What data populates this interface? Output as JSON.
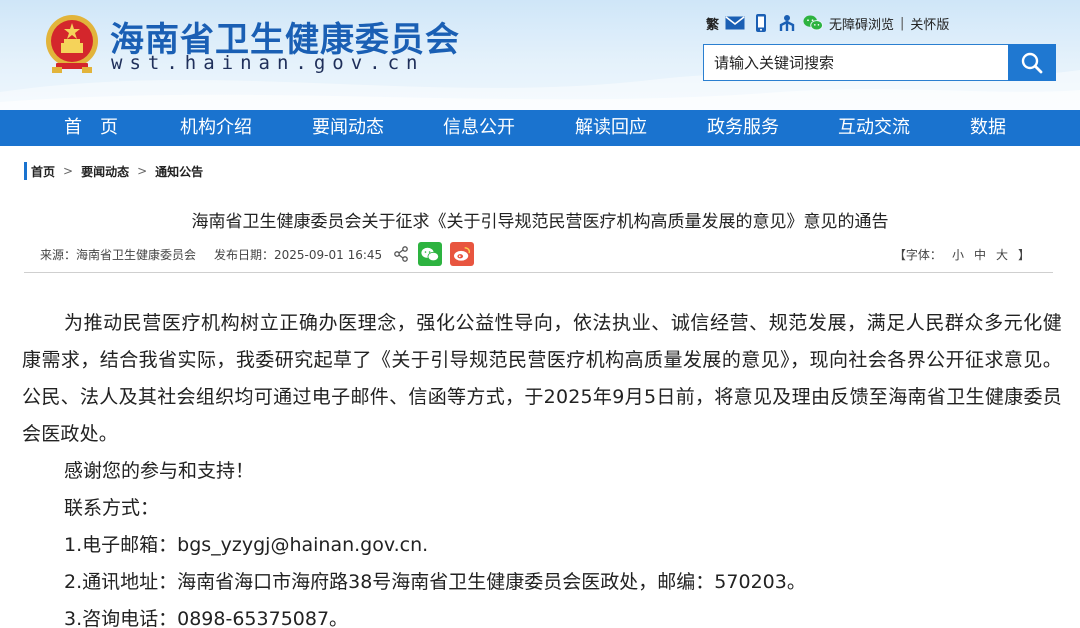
{
  "header": {
    "site_title": "海南省卫生健康委员会",
    "site_url": "wst.hainan.gov.cn",
    "tools": {
      "traditional": "繁",
      "accessibility": "无障碍浏览",
      "separator": "|",
      "care_mode": "关怀版"
    },
    "search": {
      "placeholder": "请输入关键词搜索"
    },
    "icons": [
      "mail-icon",
      "mobile-icon",
      "org-icon",
      "wechat-icon",
      "search-icon"
    ]
  },
  "nav": {
    "items": [
      "首　页",
      "机构介绍",
      "要闻动态",
      "信息公开",
      "解读回应",
      "政务服务",
      "互动交流",
      "数据"
    ]
  },
  "breadcrumb": {
    "items": [
      "首页",
      "要闻动态",
      "通知公告"
    ],
    "separator": ">"
  },
  "article": {
    "title": "海南省卫生健康委员会关于征求《关于引导规范民营医疗机构高质量发展的意见》意见的通告",
    "meta": {
      "source": "来源：海南省卫生健康委员会",
      "date": "发布日期：2025-09-01 16:45",
      "fontsize_open": "【字体：",
      "fontsize_small": "小",
      "fontsize_medium": "中",
      "fontsize_large": "大",
      "fontsize_close": "】"
    },
    "paragraph": "为推动民营医疗机构树立正确办医理念，强化公益性导向，依法执业、诚信经营、规范发展，满足人民群众多元化健康需求，结合我省实际，我委研究起草了《关于引导规范民营医疗机构高质量发展的意见》，现向社会各界公开征求意见。公民、法人及其社会组织均可通过电子邮件、信函等方式，于2025年9月5日前，将意见及理由反馈至海南省卫生健康委员会医政处。",
    "thanks": "感谢您的参与和支持！",
    "contact_heading": "联系方式：",
    "contact_email": "1.电子邮箱：bgs_yzygj@hainan.gov.cn.",
    "contact_address": "2.通讯地址：海南省海口市海府路38号海南省卫生健康委员会医政处，邮编：570203。",
    "contact_phone": "3.咨询电话：0898-65375087。"
  },
  "colors": {
    "nav_bg": "#1a73cf",
    "title_blue": "#1a5fb4",
    "wechat_green": "#2db340",
    "weibo_red": "#e8553f"
  }
}
